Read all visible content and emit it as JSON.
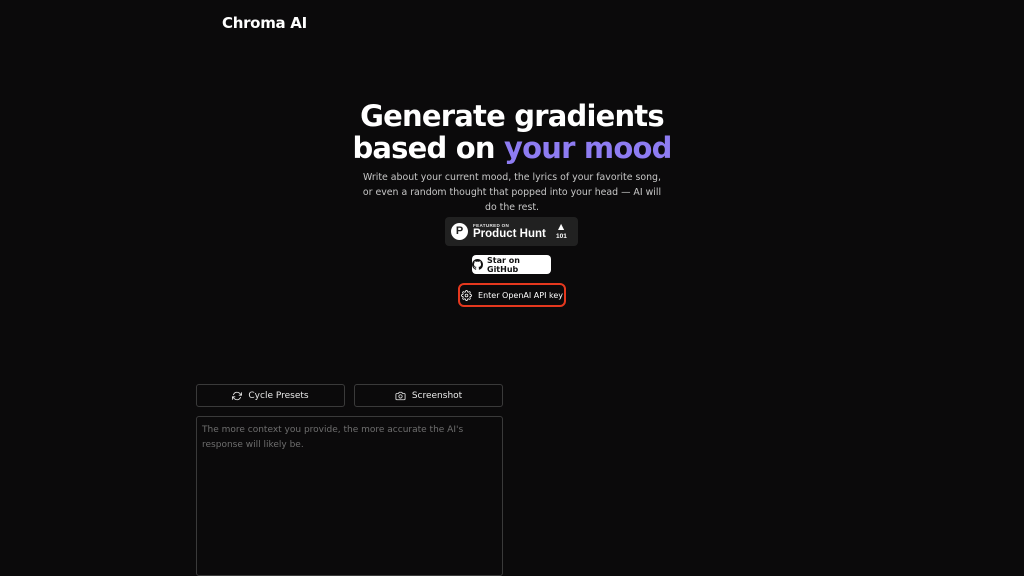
{
  "header": {
    "logo": "Chroma AI"
  },
  "hero": {
    "headline_line1": "Generate gradients",
    "headline_line2_prefix": "based on ",
    "headline_line2_accent": "your mood",
    "subtitle": "Write about your current mood, the lyrics of your favorite song, or even a random thought that popped into your head — AI will do the rest."
  },
  "product_hunt": {
    "featured_label": "FEATURED ON",
    "name": "Product Hunt",
    "upvote_count": "101",
    "icon": "product-hunt-logo-icon"
  },
  "github_button": {
    "label": "Star on GitHub",
    "icon": "github-icon"
  },
  "api_key_button": {
    "label": "Enter OpenAI API key",
    "icon": "gear-icon",
    "border_color": "#e5381e"
  },
  "toolbar": {
    "cycle_label": "Cycle Presets",
    "cycle_icon": "refresh-icon",
    "screenshot_label": "Screenshot",
    "screenshot_icon": "camera-icon"
  },
  "mood_input": {
    "value": "",
    "placeholder": "The more context you provide, the more accurate the AI's response will likely be."
  },
  "colors": {
    "background": "#0b0a0b",
    "accent": "#8e7cf2"
  }
}
